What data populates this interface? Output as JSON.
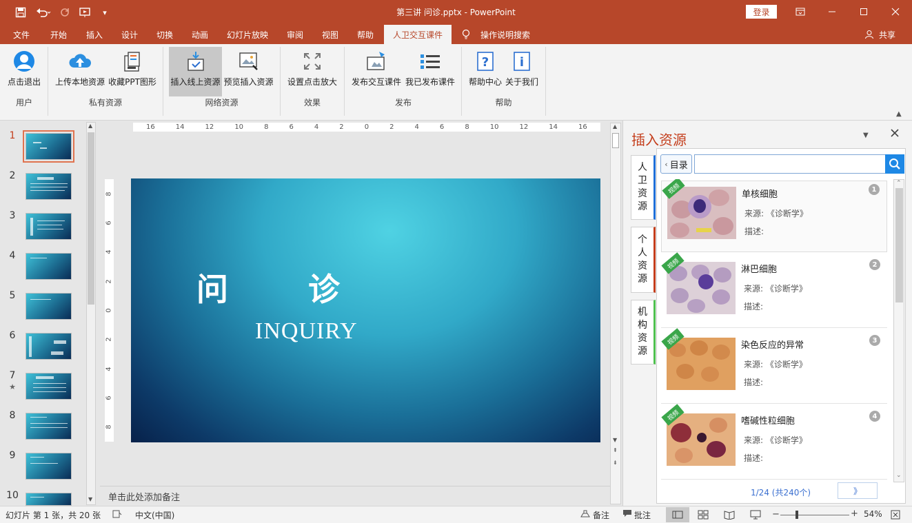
{
  "window": {
    "title": "第三讲 问诊.pptx  -  PowerPoint",
    "login_label": "登录",
    "minimize_icon": "minimize-icon",
    "colors": {
      "accent": "#b7472a",
      "ribbon_bg": "#f3f3f3"
    }
  },
  "tabs": [
    "文件",
    "开始",
    "插入",
    "设计",
    "切换",
    "动画",
    "幻灯片放映",
    "审阅",
    "视图",
    "帮助",
    "人卫交互课件"
  ],
  "tell_me": "操作说明搜索",
  "share": "共享",
  "ribbon": {
    "buttons": {
      "logout": "点击退出",
      "upload": "上传本地资源",
      "collect": "收藏PPT图形",
      "insert_online": "插入线上资源",
      "preview_insert": "预览插入资源",
      "zoom_click": "设置点击放大",
      "publish": "发布交互课件",
      "my_published": "我已发布课件",
      "help_center": "帮助中心",
      "about": "关于我们"
    },
    "groups": {
      "user": "用户",
      "private": "私有资源",
      "network": "网络资源",
      "effect": "效果",
      "publish": "发布",
      "help": "帮助"
    }
  },
  "thumbnails": [
    "1",
    "2",
    "3",
    "4",
    "5",
    "6",
    "7",
    "8",
    "9",
    "10"
  ],
  "thumb_star": "★",
  "ruler": {
    "h_labels": [
      "16",
      "14",
      "12",
      "10",
      "8",
      "6",
      "4",
      "2",
      "0",
      "2",
      "4",
      "6",
      "8",
      "10",
      "12",
      "14",
      "16"
    ],
    "v_labels": [
      "8",
      "6",
      "4",
      "2",
      "0",
      "2",
      "4",
      "6",
      "8"
    ]
  },
  "slide": {
    "title": "问 诊",
    "subtitle": "INQUIRY"
  },
  "notes_placeholder": "单击此处添加备注",
  "pane": {
    "title": "插入资源",
    "back_label": "目录",
    "search_placeholder": "",
    "vertical_tabs": [
      "人卫资源",
      "个人资源",
      "机构资源"
    ],
    "vertical_tab_colors": [
      "#1e6fd9",
      "#c43e1c",
      "#4fc14f"
    ],
    "ribbon_tag": "视频",
    "items": [
      {
        "num": "1",
        "name": "单核细胞",
        "source": "来源:  《诊断学》",
        "desc": "描述:"
      },
      {
        "num": "2",
        "name": "淋巴细胞",
        "source": "来源:  《诊断学》",
        "desc": "描述:"
      },
      {
        "num": "3",
        "name": "染色反应的异常",
        "source": "来源:  《诊断学》",
        "desc": "描述:"
      },
      {
        "num": "4",
        "name": "嗜碱性粒细胞",
        "source": "来源:  《诊断学》",
        "desc": "描述:"
      }
    ],
    "pagination": "1/24 (共240个)",
    "next_label": "》"
  },
  "status": {
    "slide_info": "幻灯片 第 1 张，共 20 张",
    "language": "中文(中国)",
    "notes": "备注",
    "comments": "批注",
    "zoom": "54%"
  }
}
